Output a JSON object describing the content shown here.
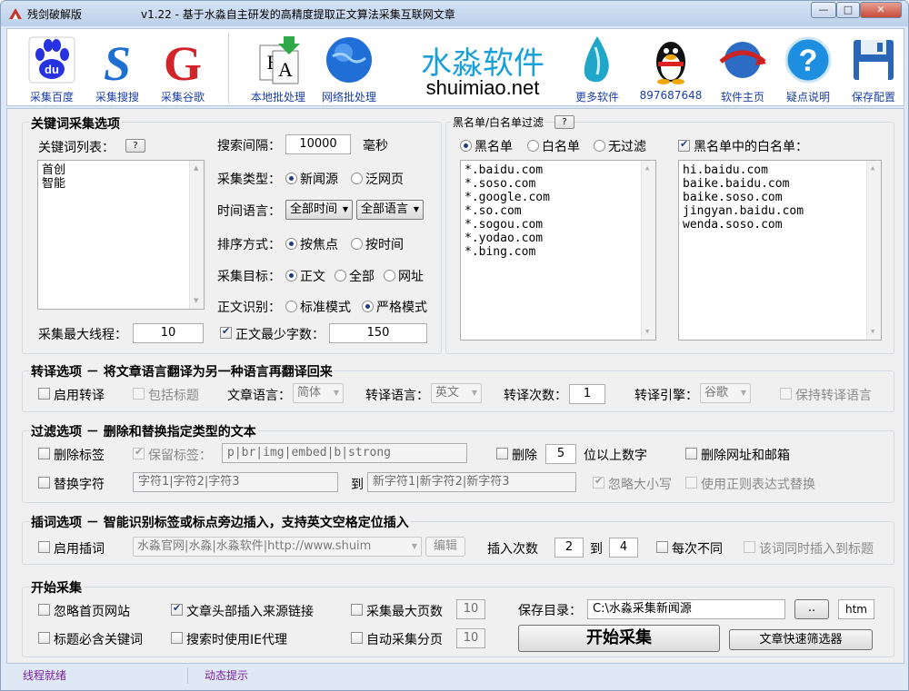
{
  "window": {
    "title_app": "残剑破解版",
    "title_main": "v1.22 - 基于水淼自主研发的高精度提取正文算法采集互联网文章",
    "min": "—",
    "max": "□",
    "close": "✕"
  },
  "toolbar": {
    "baidu": "采集百度",
    "sogou": "采集搜搜",
    "google": "采集谷歌",
    "local": "本地批处理",
    "net": "网络批处理",
    "brand_cn": "水淼软件",
    "brand_en": "shuimiao.net",
    "more": "更多软件",
    "qq": "897687648",
    "home": "软件主页",
    "help": "疑点说明",
    "save": "保存配置"
  },
  "kw": {
    "title": "关键词采集选项",
    "list_label": "关键词列表：",
    "keywords": [
      "首创",
      "智能"
    ],
    "max_threads_label": "采集最大线程：",
    "max_threads": "10",
    "interval_label": "搜索间隔：",
    "interval": "10000",
    "ms": "毫秒",
    "type_label": "采集类型：",
    "type_news": "新闻源",
    "type_web": "泛网页",
    "timelang_label": "时间语言：",
    "time": "全部时间",
    "lang": "全部语言",
    "sort_label": "排序方式：",
    "sort_focus": "按焦点",
    "sort_time": "按时间",
    "target_label": "采集目标：",
    "t_body": "正文",
    "t_all": "全部",
    "t_url": "网址",
    "recog_label": "正文识别：",
    "r_std": "标准模式",
    "r_strict": "严格模式",
    "minchars_label": "正文最少字数：",
    "minchars": "150"
  },
  "filter": {
    "title": "黑名单/白名单过滤",
    "black": "黑名单",
    "white": "白名单",
    "none": "无过滤",
    "white_in_black": "黑名单中的白名单：",
    "black_list": [
      "*.baidu.com",
      "*.soso.com",
      "*.google.com",
      "*.so.com",
      "*.sogou.com",
      "*.yodao.com",
      "*.bing.com"
    ],
    "white_list": [
      "hi.baidu.com",
      "baike.baidu.com",
      "baike.soso.com",
      "jingyan.baidu.com",
      "wenda.soso.com"
    ]
  },
  "trans": {
    "title": "转译选项 － 将文章语言翻译为另一种语言再翻译回来",
    "enable": "启用转译",
    "incl_title": "包括标题",
    "art_lang_label": "文章语言：",
    "art_lang": "简体",
    "to_lang_label": "转译语言：",
    "to_lang": "英文",
    "times_label": "转译次数：",
    "times": "1",
    "engine_label": "转译引擎：",
    "engine": "谷歌",
    "keep": "保持转译语言"
  },
  "filt": {
    "title": "过滤选项 － 删除和替换指定类型的文本",
    "del_tags": "删除标签",
    "keep_tags": "保留标签：",
    "tags": "p|br|img|embed|b|strong",
    "del": "删除",
    "digits": "5",
    "digits_suffix": "位以上数字",
    "del_url": "删除网址和邮箱",
    "replace": "替换字符",
    "from": "字符1|字符2|字符3",
    "to_label": "到",
    "to": "新字符1|新字符2|新字符3",
    "ignore_case": "忽略大小写",
    "regex": "使用正则表达式替换"
  },
  "insert": {
    "title": "插词选项 － 智能识别标签或标点旁边插入，支持英文空格定位插入",
    "enable": "启用插词",
    "words": "水淼官网|水淼|水淼软件|http://www.shuim",
    "edit": "编辑",
    "count_label": "插入次数",
    "from": "2",
    "to_label": "到",
    "to": "4",
    "each_diff": "每次不同",
    "into_title": "该词同时插入到标题"
  },
  "start": {
    "title": "开始采集",
    "ignore_home": "忽略首页网站",
    "insert_src": "文章头部插入来源链接",
    "max_pages_label": "采集最大页数",
    "max_pages": "10",
    "save_dir_label": "保存目录：",
    "save_dir": "C:\\水淼采集新闻源",
    "browse": "..",
    "ext": "htm",
    "title_kw": "标题必含关键词",
    "ie_proxy": "搜索时使用IE代理",
    "auto_pages_label": "自动采集分页",
    "auto_pages": "10",
    "start_btn": "开始采集",
    "quick_filter": "文章快速筛选器"
  },
  "status": {
    "thread": "线程就绪",
    "tip": "动态提示"
  }
}
